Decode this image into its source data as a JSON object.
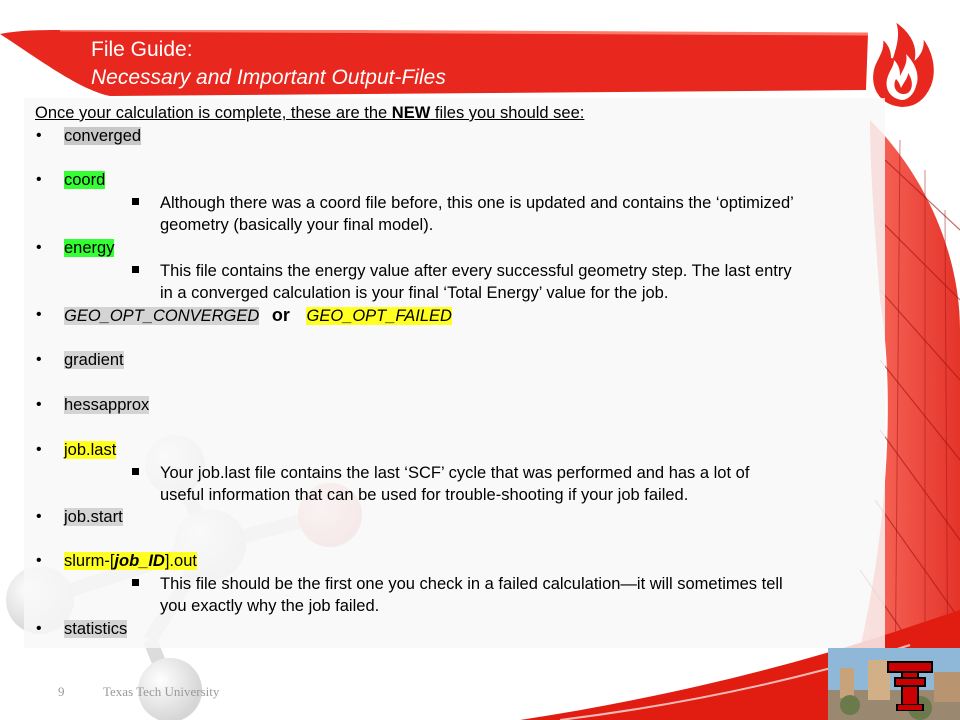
{
  "title": {
    "line1": "File Guide:",
    "line2": "Necessary and Important Output-Files"
  },
  "intro": {
    "pre": "Once your calculation is complete, these are the ",
    "bold": "NEW",
    "post": " files you should see:"
  },
  "items": {
    "converged": "converged",
    "coord": "coord",
    "coord_note1": "Although there was a coord file before, this one is updated and contains the ‘optimized’",
    "coord_note2": "geometry (basically your final model).",
    "energy": "energy",
    "energy_note1": "This file contains the energy value after every successful geometry step. The last entry",
    "energy_note2": "in a converged calculation is your final ‘Total Energy’ value for the job.",
    "geo_converged": "GEO_OPT_CONVERGED",
    "or": "or",
    "geo_failed": "GEO_OPT_FAILED",
    "gradient": "gradient",
    "hessapprox": "hessapprox",
    "job_last": "job.last",
    "job_last_note1": "Your job.last file contains the last ‘SCF’ cycle that was performed and has a lot of",
    "job_last_note2": "useful information that can be used for trouble-shooting if your job failed.",
    "job_start": "job.start",
    "slurm_pre": "slurm-[",
    "slurm_mid": "job_ID",
    "slurm_post": "].out",
    "slurm_note1": "This file should be the first one you check in a failed calculation—it will sometimes tell",
    "slurm_note2": "you exactly why the job failed.",
    "statistics": "statistics"
  },
  "bullet_char": "•",
  "footer": {
    "page_number": "9",
    "university": "Texas Tech University"
  },
  "logo": {
    "monogram": "TT"
  },
  "colors": {
    "brand_red": "#e8281e",
    "highlight_green": "#33ff33",
    "highlight_yellow": "#ffff22",
    "highlight_gray": "#c8c8c8"
  },
  "icons": [
    "flame-logo-icon",
    "double-t-logo-icon",
    "molecule-decoration",
    "campus-photo"
  ]
}
